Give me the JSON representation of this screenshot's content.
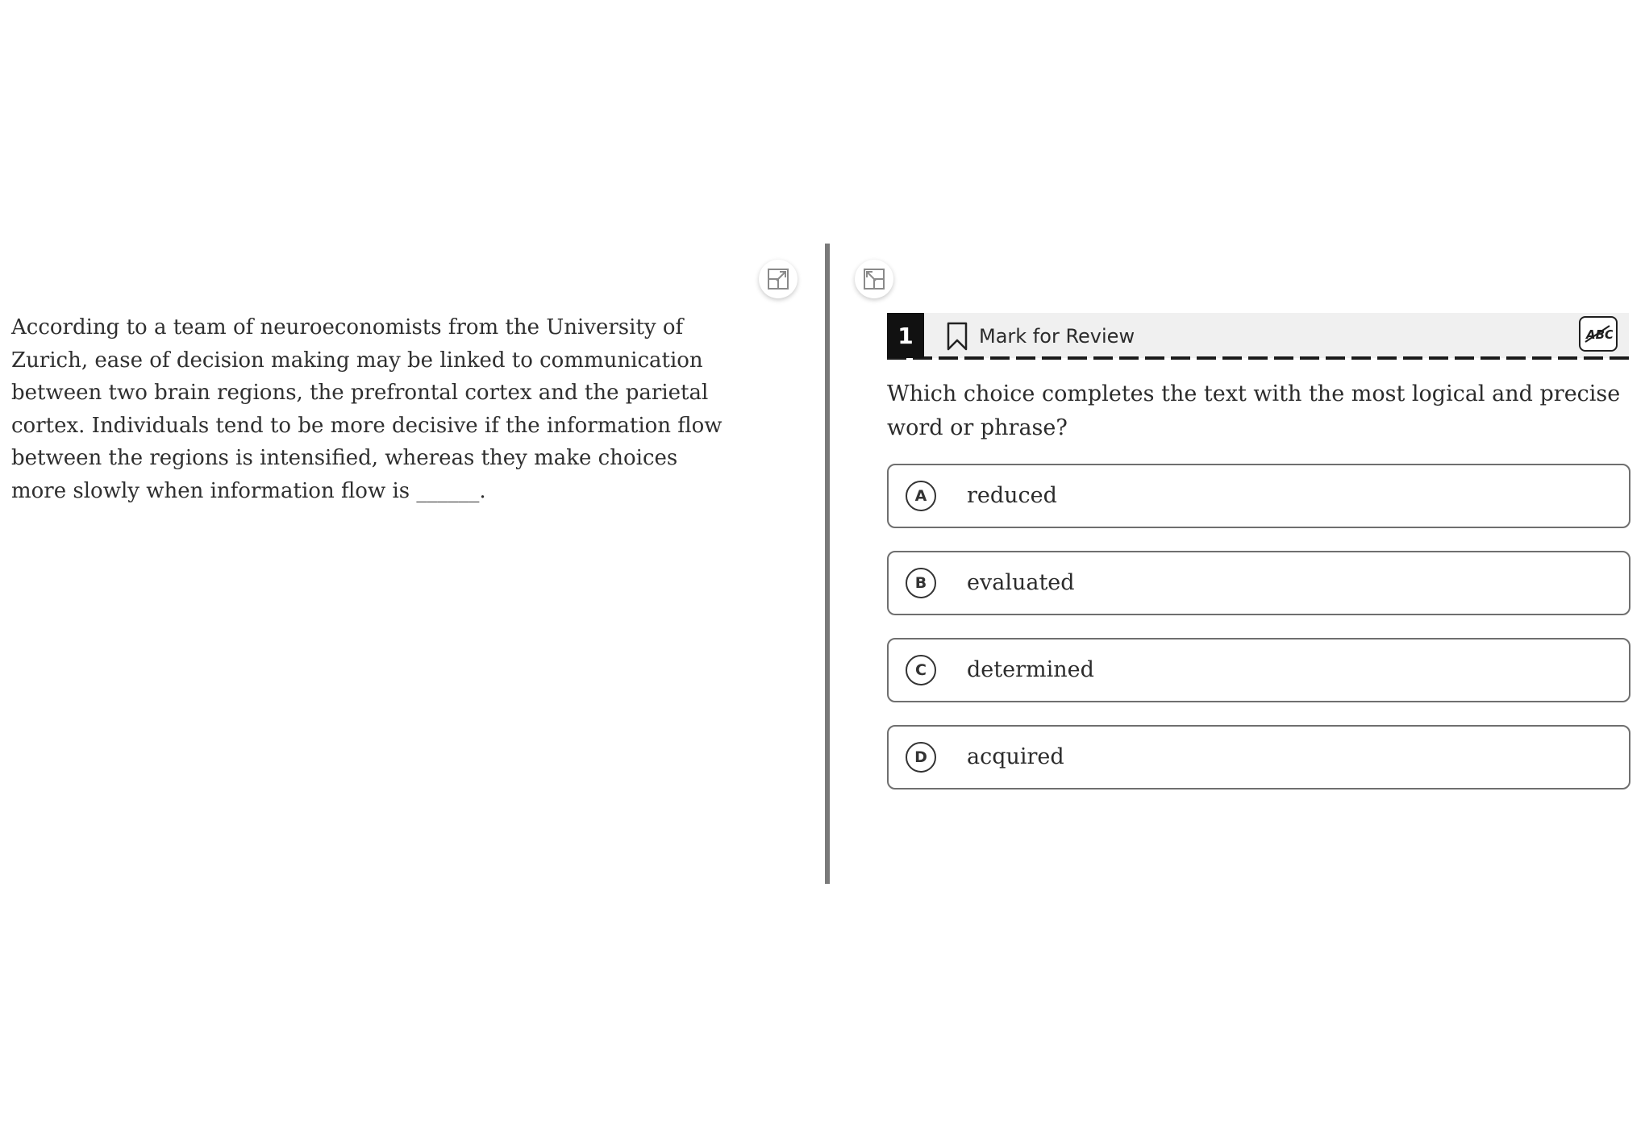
{
  "passage": {
    "text": "According to a team of neuroeconomists from the University of Zurich, ease of decision making may be linked to communication between two brain regions, the prefrontal cortex and the parietal cortex. Individuals tend to be more decisive if the information flow between the regions is intensified, whereas they make choices more slowly when information flow is ______."
  },
  "toolbar": {
    "expand_left_icon": "expand-icon",
    "expand_right_icon": "collapse-icon"
  },
  "question_header": {
    "number": "1",
    "mark_for_review_label": "Mark for Review",
    "bookmark_icon": "bookmark-icon",
    "abc_icon": "abc-strikethrough-icon"
  },
  "question": {
    "prompt": "Which choice completes the text with the most logical and precise word or phrase?"
  },
  "choices": [
    {
      "letter": "A",
      "text": "reduced"
    },
    {
      "letter": "B",
      "text": "evaluated"
    },
    {
      "letter": "C",
      "text": "determined"
    },
    {
      "letter": "D",
      "text": "acquired"
    }
  ]
}
